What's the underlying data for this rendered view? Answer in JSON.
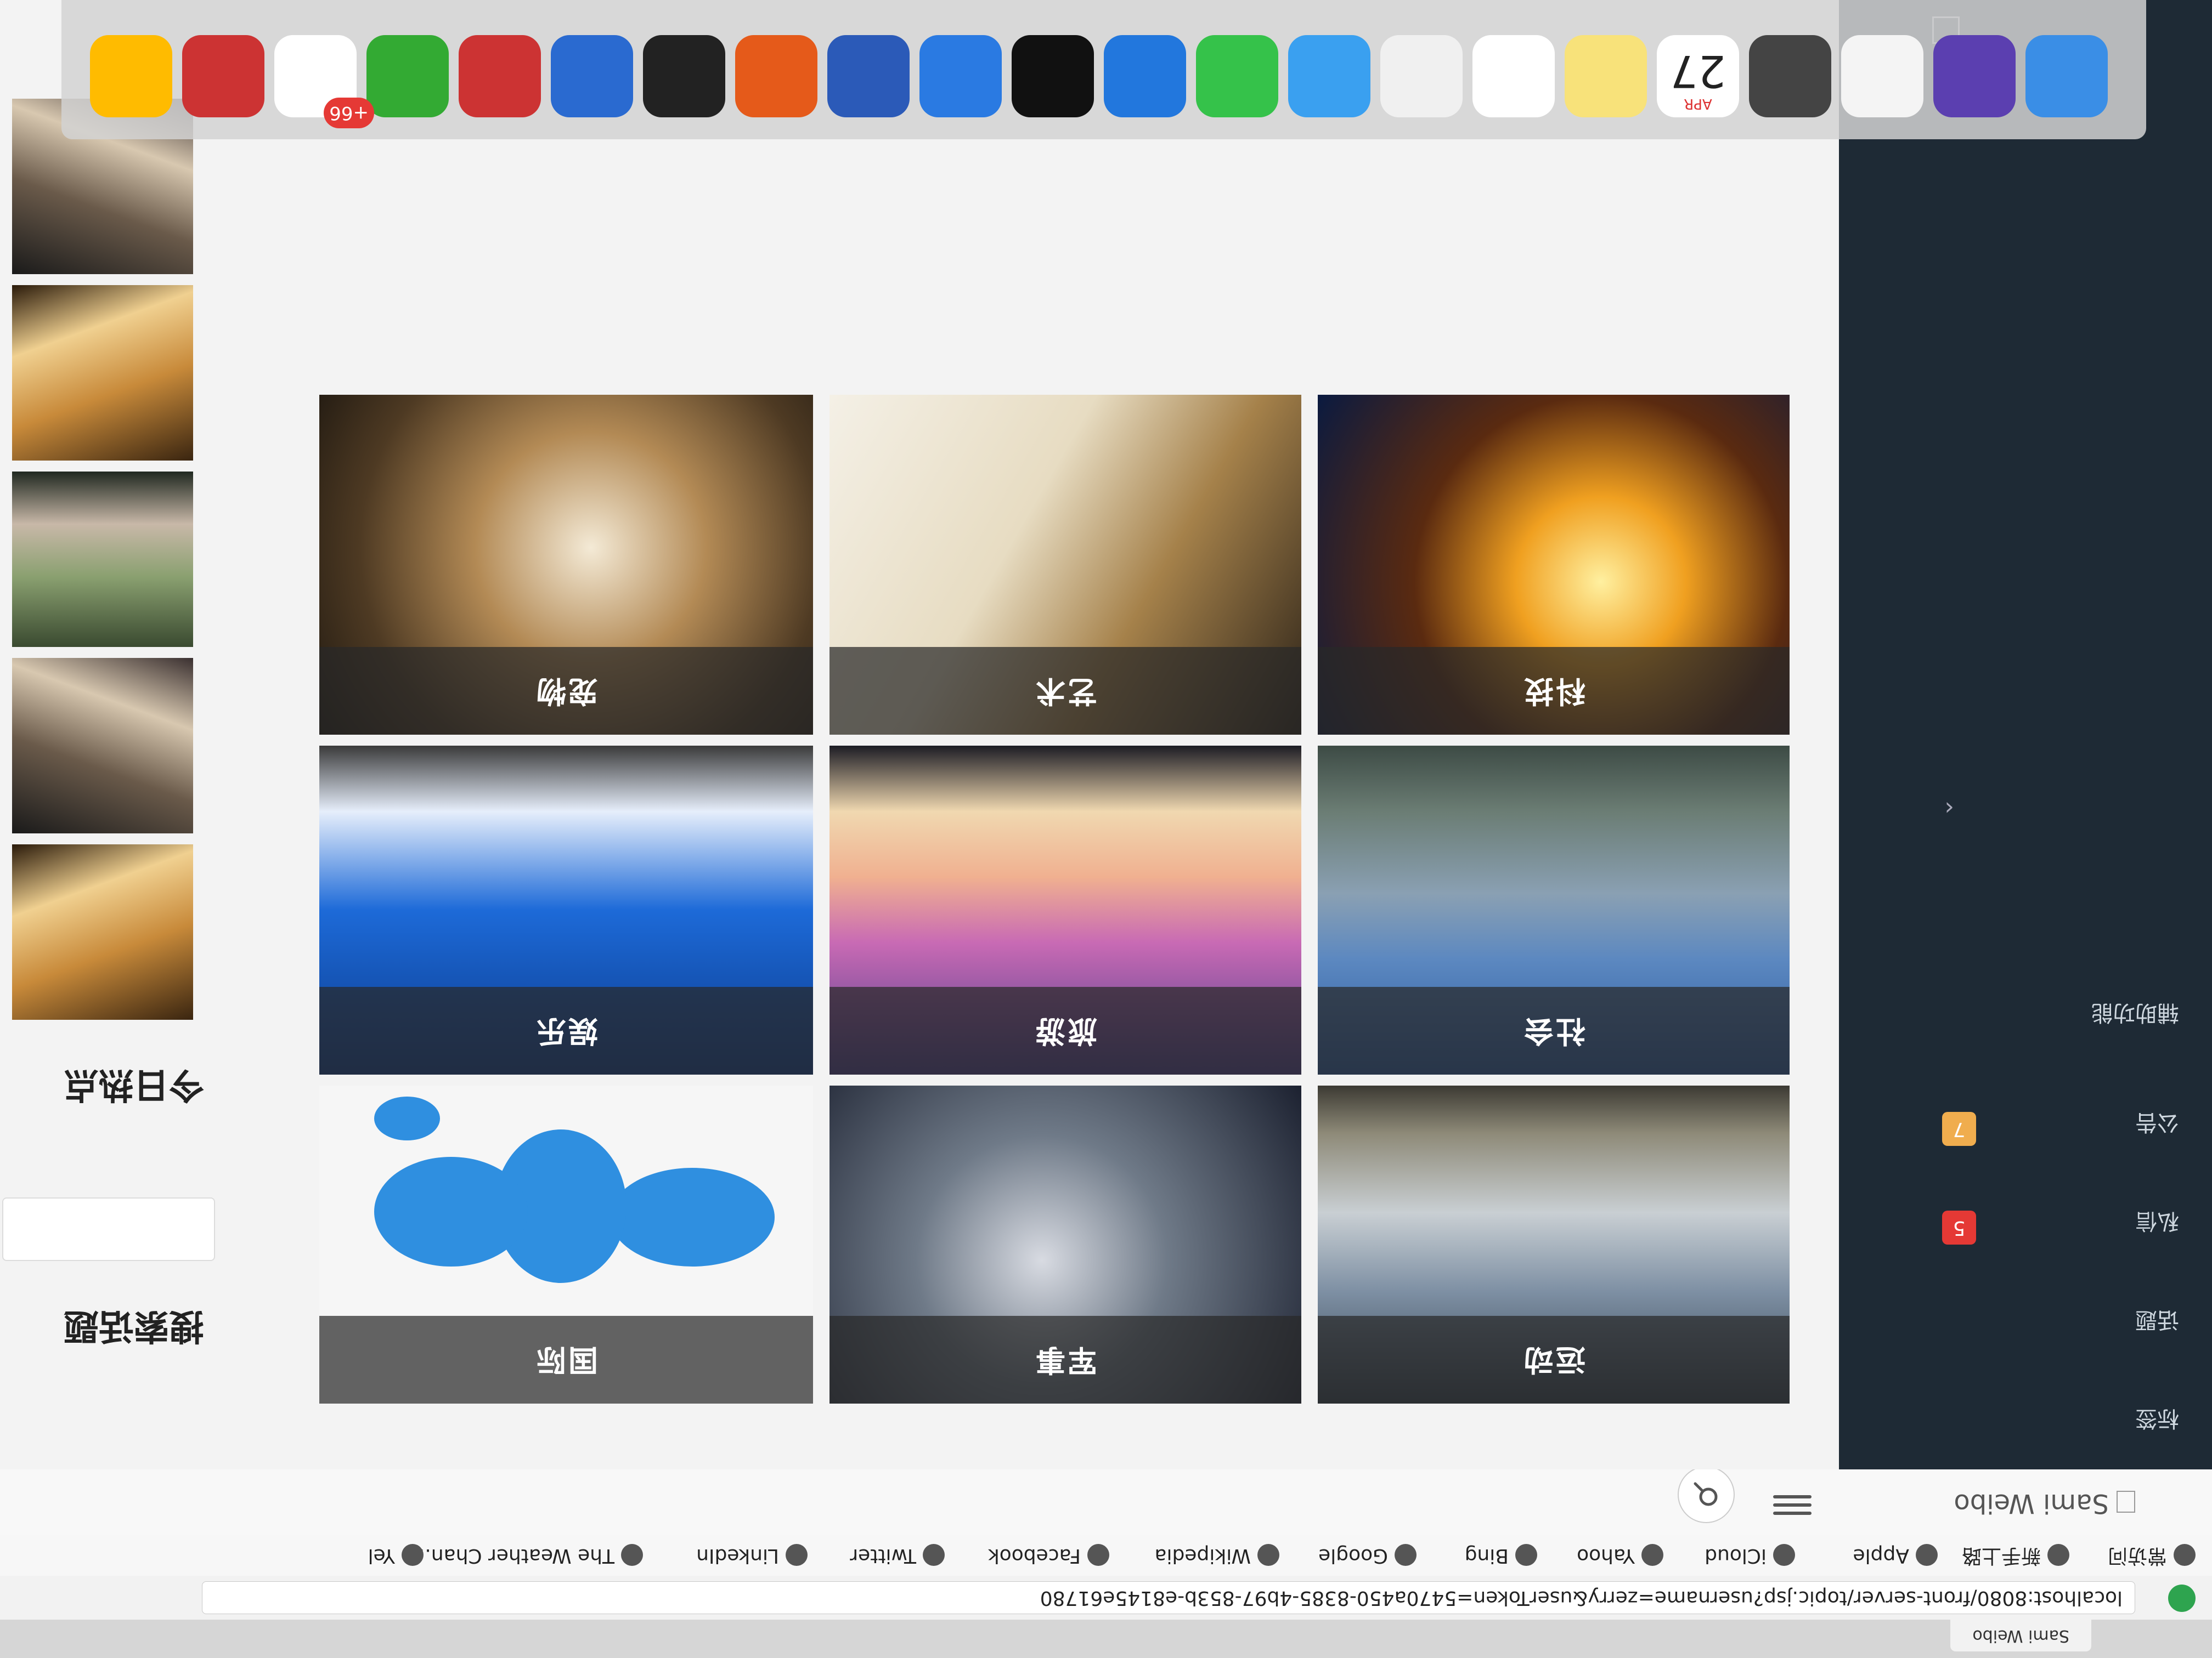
{
  "browser": {
    "tab_title": "Sami Weibo",
    "url": "localhost:8080/front-server/topic.jsp?username=zerry&userToken=5470a450-8385-4b97-853b-e8145e61780",
    "bookmarks": [
      {
        "label": "常访问",
        "icon": "globe-icon"
      },
      {
        "label": "新手上路",
        "icon": "globe-icon"
      },
      {
        "label": "Apple",
        "icon": "globe-icon"
      },
      {
        "label": "iCloud",
        "icon": "apple-icon"
      },
      {
        "label": "Yahoo",
        "icon": "globe-icon"
      },
      {
        "label": "Bing",
        "icon": "bing-icon"
      },
      {
        "label": "Google",
        "icon": "globe-icon"
      },
      {
        "label": "Wikipedia",
        "icon": "wikipedia-icon"
      },
      {
        "label": "Facebook",
        "icon": "globe-icon"
      },
      {
        "label": "Twitter",
        "icon": "globe-icon"
      },
      {
        "label": "LinkedIn",
        "icon": "globe-icon"
      },
      {
        "label": "The Weather Chan...",
        "icon": "twc-icon"
      },
      {
        "label": "Yel",
        "icon": "globe-icon"
      }
    ]
  },
  "app": {
    "brand": "Sami Weibo"
  },
  "sidebar": {
    "items": [
      {
        "label": "标签"
      },
      {
        "label": "话题"
      },
      {
        "label": "私信",
        "badge": "5",
        "badge_color": "#e53935"
      },
      {
        "label": "公告",
        "badge": "7",
        "badge_color": "#f0ad4e"
      },
      {
        "label": "辅助功能"
      }
    ]
  },
  "topics": [
    {
      "label": "运动",
      "theme": "sport"
    },
    {
      "label": "军事",
      "theme": "military"
    },
    {
      "label": "国际",
      "theme": "international"
    },
    {
      "label": "社会",
      "theme": "society"
    },
    {
      "label": "旅游",
      "theme": "travel"
    },
    {
      "label": "娱乐",
      "theme": "entertainment"
    },
    {
      "label": "科技",
      "theme": "tech"
    },
    {
      "label": "艺术",
      "theme": "art"
    },
    {
      "label": "宠物",
      "theme": "pet"
    }
  ],
  "right_panel": {
    "search_title": "搜索话题",
    "search_placeholder": "",
    "hot_title": "今日热点"
  },
  "dock": {
    "calendar_month": "APR",
    "calendar_day": "27",
    "badge": "+66"
  },
  "colors": {
    "sidebar_bg": "#1e2a35",
    "badge_red": "#e53935",
    "badge_orange": "#f0ad4e",
    "url_bar_accent": "#2ea44f"
  }
}
